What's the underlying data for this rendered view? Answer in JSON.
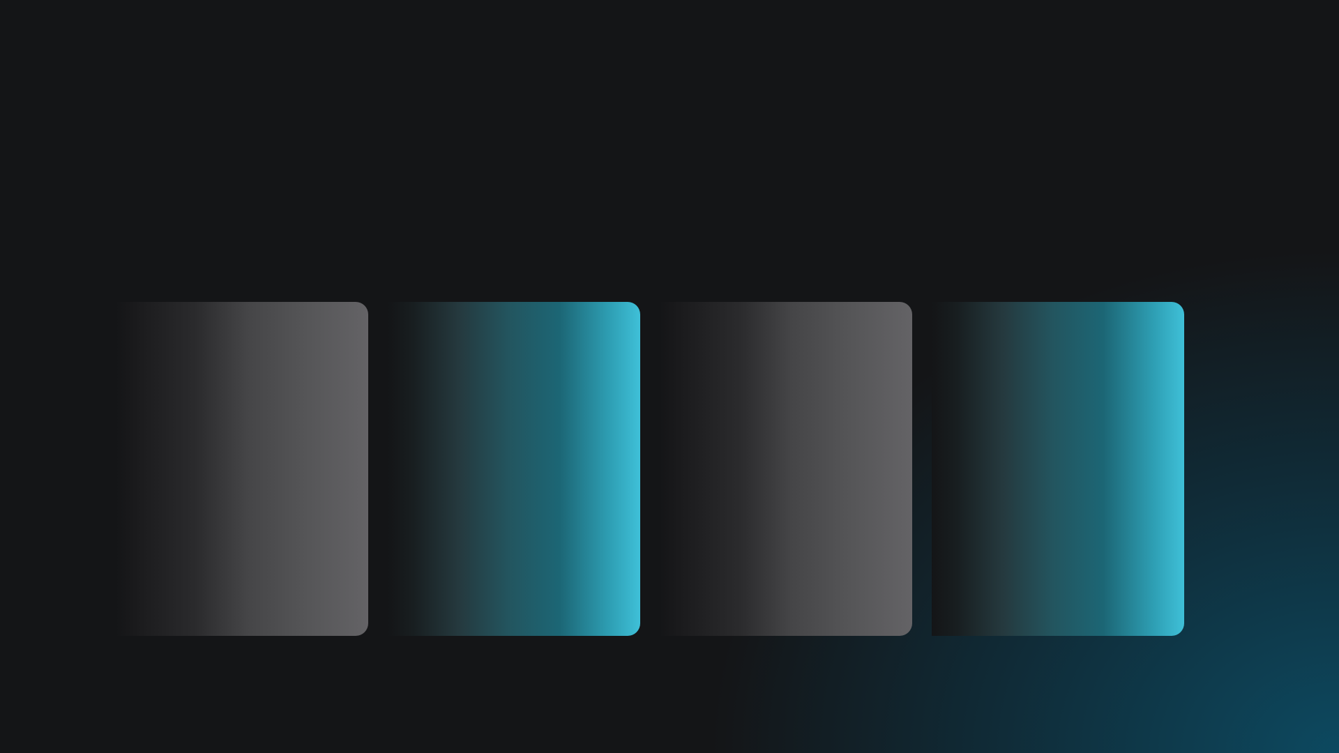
{
  "background": {
    "base_color": "#141517",
    "glow_color": "#0c4c64"
  },
  "panels": [
    {
      "id": "panel-1",
      "style": "grey",
      "start_color": "#141517",
      "end_color": "#646366"
    },
    {
      "id": "panel-2",
      "style": "teal",
      "start_color": "#141517",
      "end_color": "#3fc0d8"
    },
    {
      "id": "panel-3",
      "style": "grey",
      "start_color": "#141517",
      "end_color": "#646366"
    },
    {
      "id": "panel-4",
      "style": "teal",
      "start_color": "#141517",
      "end_color": "#3fc0d8"
    }
  ]
}
